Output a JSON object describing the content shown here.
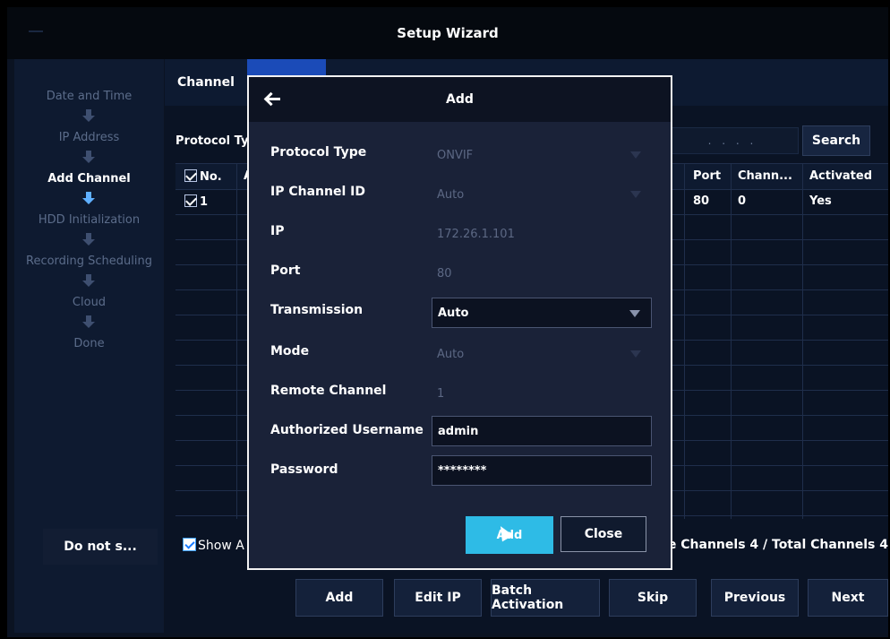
{
  "window": {
    "title": "Setup Wizard"
  },
  "sidebar": {
    "steps": [
      {
        "label": "Date and Time",
        "active": false
      },
      {
        "label": "IP Address",
        "active": false
      },
      {
        "label": "Add Channel",
        "active": true
      },
      {
        "label": "HDD Initialization",
        "active": false
      },
      {
        "label": "Recording Scheduling",
        "active": false
      },
      {
        "label": "Cloud",
        "active": false
      },
      {
        "label": "Done",
        "active": false
      }
    ],
    "do_not_show_label": "Do not s..."
  },
  "tabs": {
    "channel": "Channel",
    "search": "Search"
  },
  "toolbar": {
    "protocol_label": "Protocol Ty",
    "ip_range_dots": ". . . .",
    "search_button": "Search"
  },
  "table": {
    "headers": {
      "no": "No.",
      "a": "A",
      "port": "Port",
      "channel": "Chann...",
      "activated": "Activated"
    },
    "rows": [
      {
        "no": "1",
        "port": "80",
        "channel": "0",
        "activated": "Yes"
      }
    ]
  },
  "footer": {
    "show_all": "Show A",
    "channels_status": "e Channels 4 / Total Channels 4",
    "buttons": {
      "add": "Add",
      "edit_ip": "Edit IP",
      "batch_activation": "Batch Activation",
      "skip": "Skip",
      "previous": "Previous",
      "next": "Next"
    }
  },
  "dialog": {
    "title": "Add",
    "fields": {
      "protocol_type": {
        "label": "Protocol Type",
        "value": "ONVIF"
      },
      "ip_channel_id": {
        "label": "IP Channel ID",
        "value": "Auto"
      },
      "ip": {
        "label": "IP",
        "value": "172.26.1.101"
      },
      "port": {
        "label": "Port",
        "value": "80"
      },
      "transmission": {
        "label": "Transmission",
        "value": "Auto"
      },
      "mode": {
        "label": "Mode",
        "value": "Auto"
      },
      "remote_channel": {
        "label": "Remote Channel",
        "value": "1"
      },
      "username": {
        "label": "Authorized Username",
        "value": "admin"
      },
      "password": {
        "label": "Password",
        "value": "********"
      }
    },
    "add_button": "Add",
    "close_button": "Close"
  }
}
